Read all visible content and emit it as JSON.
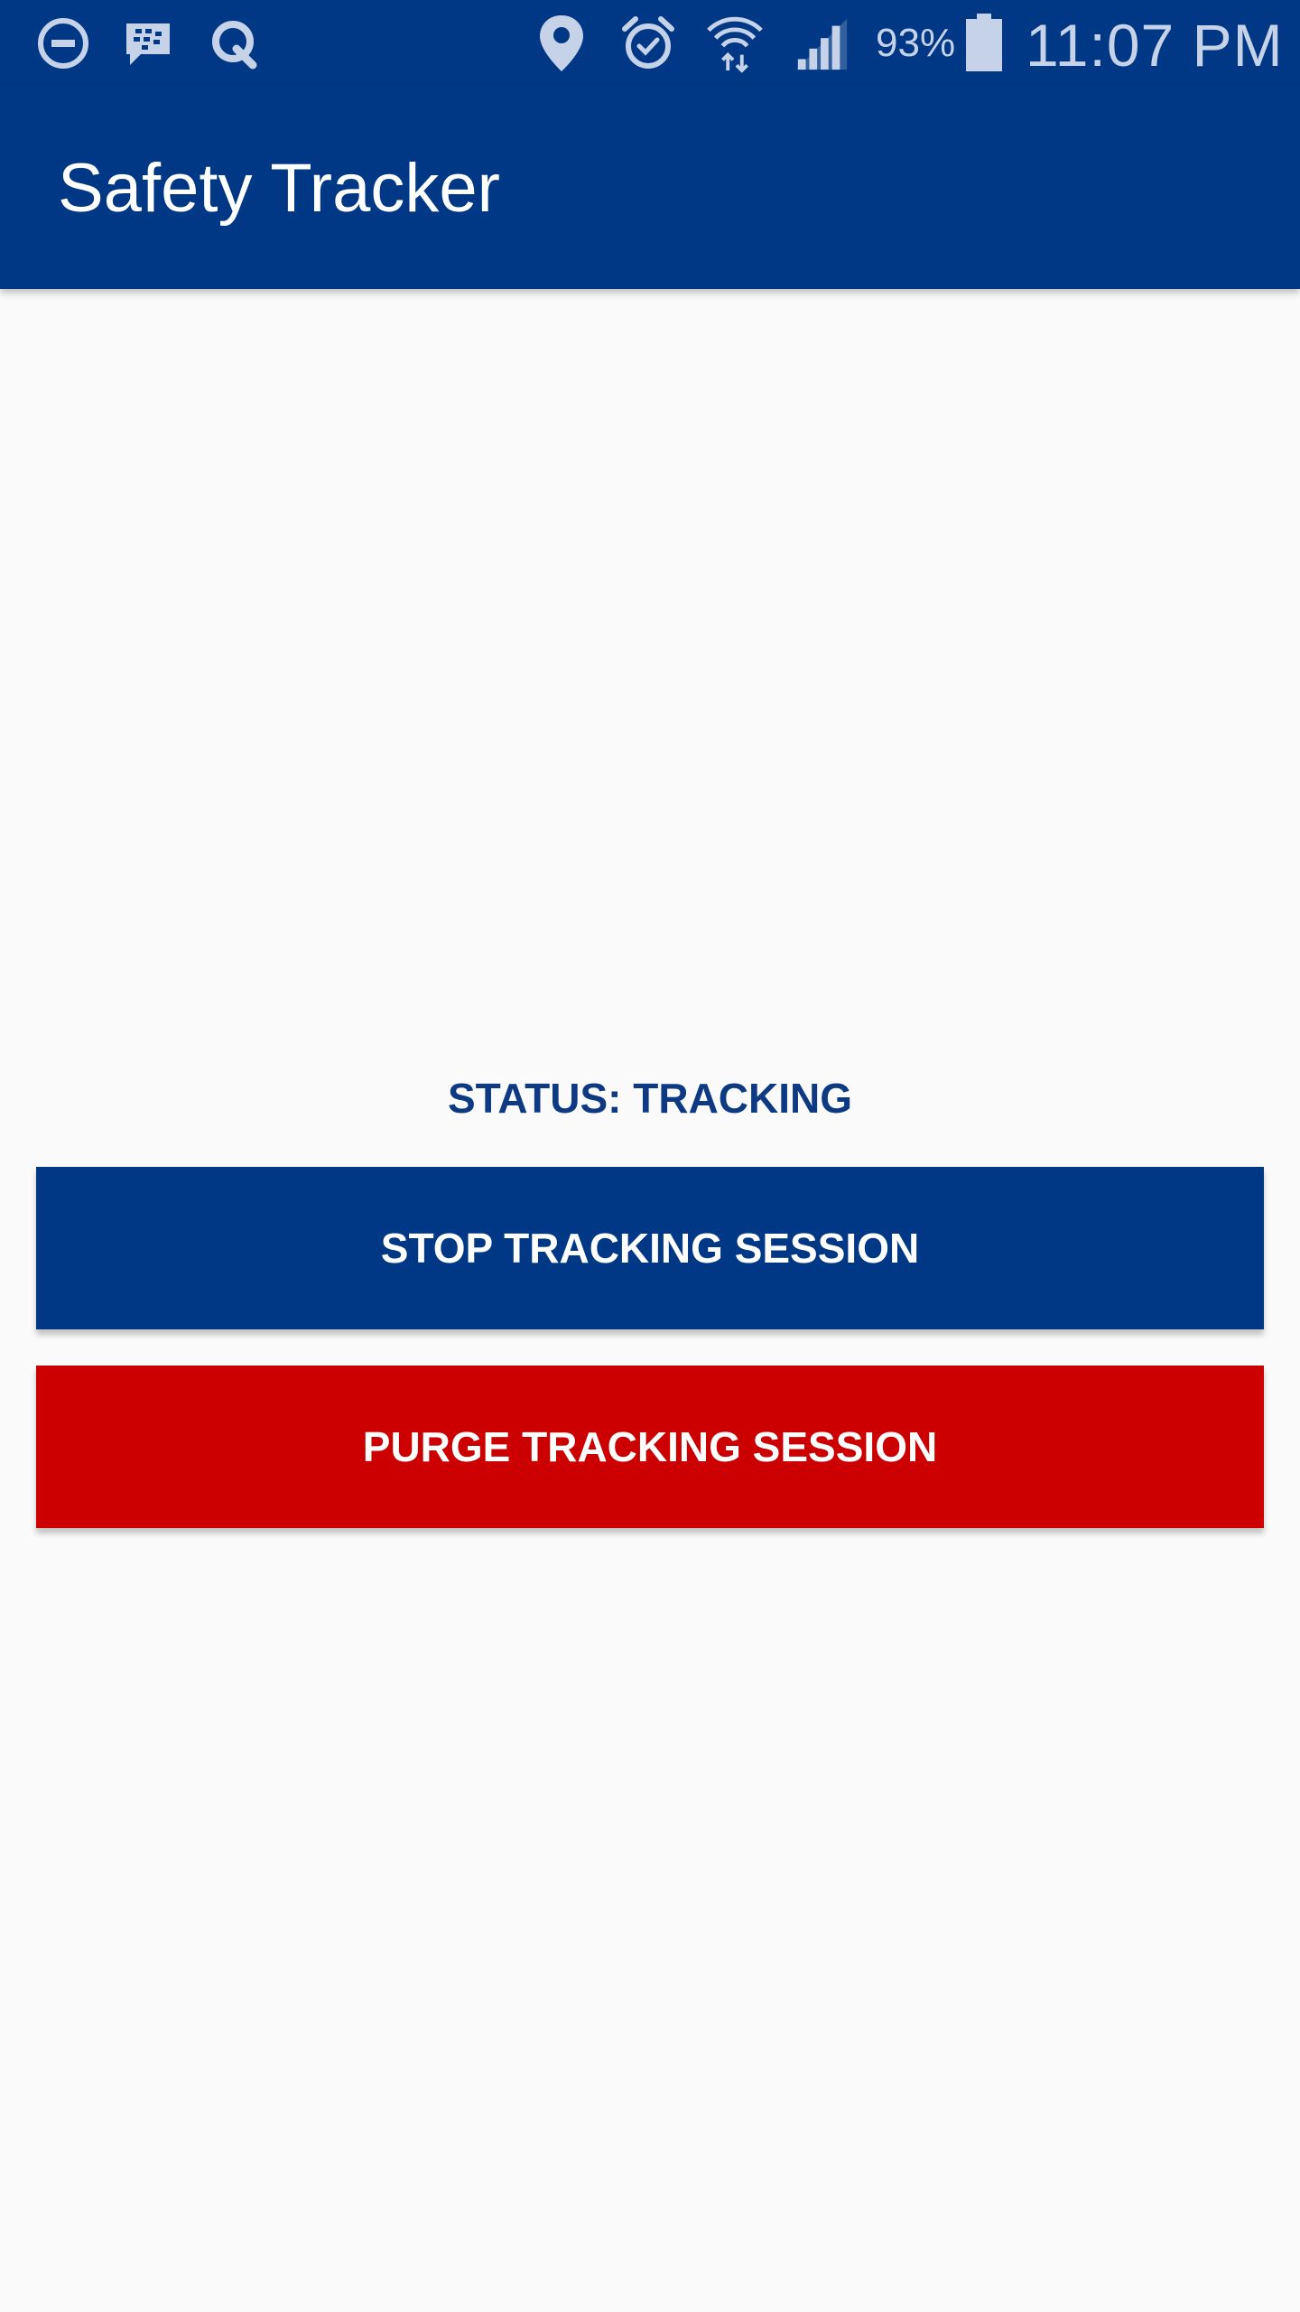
{
  "status_bar": {
    "battery_percent": "93%",
    "time": "11:07 PM",
    "icons": [
      "do-not-disturb-icon",
      "blackberry-messenger-icon",
      "q-app-icon",
      "location-icon",
      "alarm-icon",
      "wifi-icon",
      "signal-icon",
      "battery-icon"
    ]
  },
  "app_bar": {
    "title": "Safety Tracker"
  },
  "main": {
    "status_text": "STATUS: TRACKING",
    "stop_button_label": "STOP TRACKING SESSION",
    "purge_button_label": "PURGE TRACKING SESSION"
  },
  "colors": {
    "primary": "#003885",
    "danger": "#cc0000",
    "background": "#fafafa",
    "status_text": "#0d3a82"
  }
}
